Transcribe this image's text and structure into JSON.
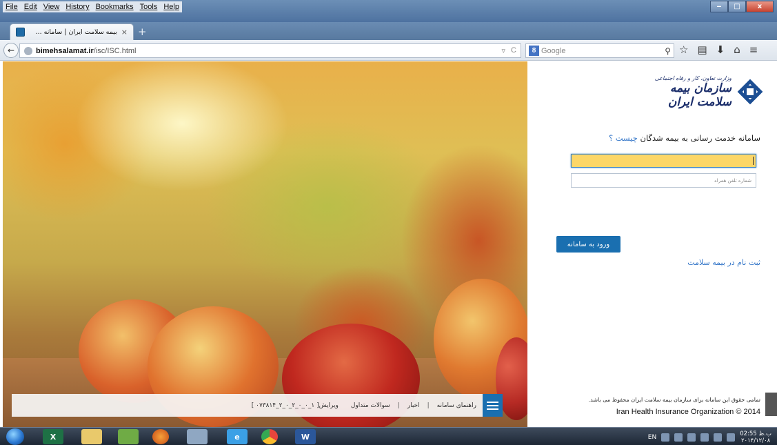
{
  "browser": {
    "menu": [
      "File",
      "Edit",
      "View",
      "History",
      "Bookmarks",
      "Tools",
      "Help"
    ],
    "window_controls": {
      "minimize": "‒",
      "maximize": "□",
      "close": "x"
    },
    "tab": {
      "title": "بیمه سلامت ایران | سامانه ...",
      "close": "×"
    },
    "new_tab": "+",
    "back": "←",
    "url": {
      "domain": "bimehsalamat.ir",
      "path": "/isc/ISC.html"
    },
    "url_right": {
      "dropdown": "▿",
      "reload": "C"
    },
    "search": {
      "engine": "8",
      "placeholder": "Google",
      "glass": "⚲"
    },
    "nav_icons": [
      "☆",
      "▤",
      "⬇",
      "⌂",
      "≡"
    ]
  },
  "page": {
    "logo": {
      "small": "وزارت تعاون، کار و رفاه اجتماعی",
      "main": "سازمان بیمه سلامت ایران"
    },
    "headline": {
      "text": "سامانه خدمت رسانی به بیمه شدگان",
      "link": "چیست ؟"
    },
    "fields": {
      "phone_placeholder": "شماره تلفن همراه"
    },
    "login_button": "ورود به سامانه",
    "register_link": "ثبت نام در بیمه سلامت",
    "copyright_fa": "تمامی حقوق این سامانه برای سازمان بیمه سلامت ایران محفوظ می باشد.",
    "copyright_en": "Iran Health Insurance Organization © 2014",
    "footer": {
      "guide": "راهنمای سامانه",
      "news": "اخبار",
      "faq": "سوالات متداول",
      "version": "ویرایش[ ۱_۰_۰_۲_۰_۲_۰۷۳۸۱۴ ]",
      "separator": "|"
    }
  },
  "taskbar": {
    "apps": [
      "excel",
      "explorer",
      "tool",
      "firefox",
      "calculator",
      "internet-explorer",
      "chrome",
      "word"
    ],
    "excel_label": "X",
    "word_label": "W",
    "ie_label": "e",
    "lang": "EN",
    "time": "02:55 ب.ظ",
    "date": "۲۰۱۴/۱۲/۰۸"
  }
}
